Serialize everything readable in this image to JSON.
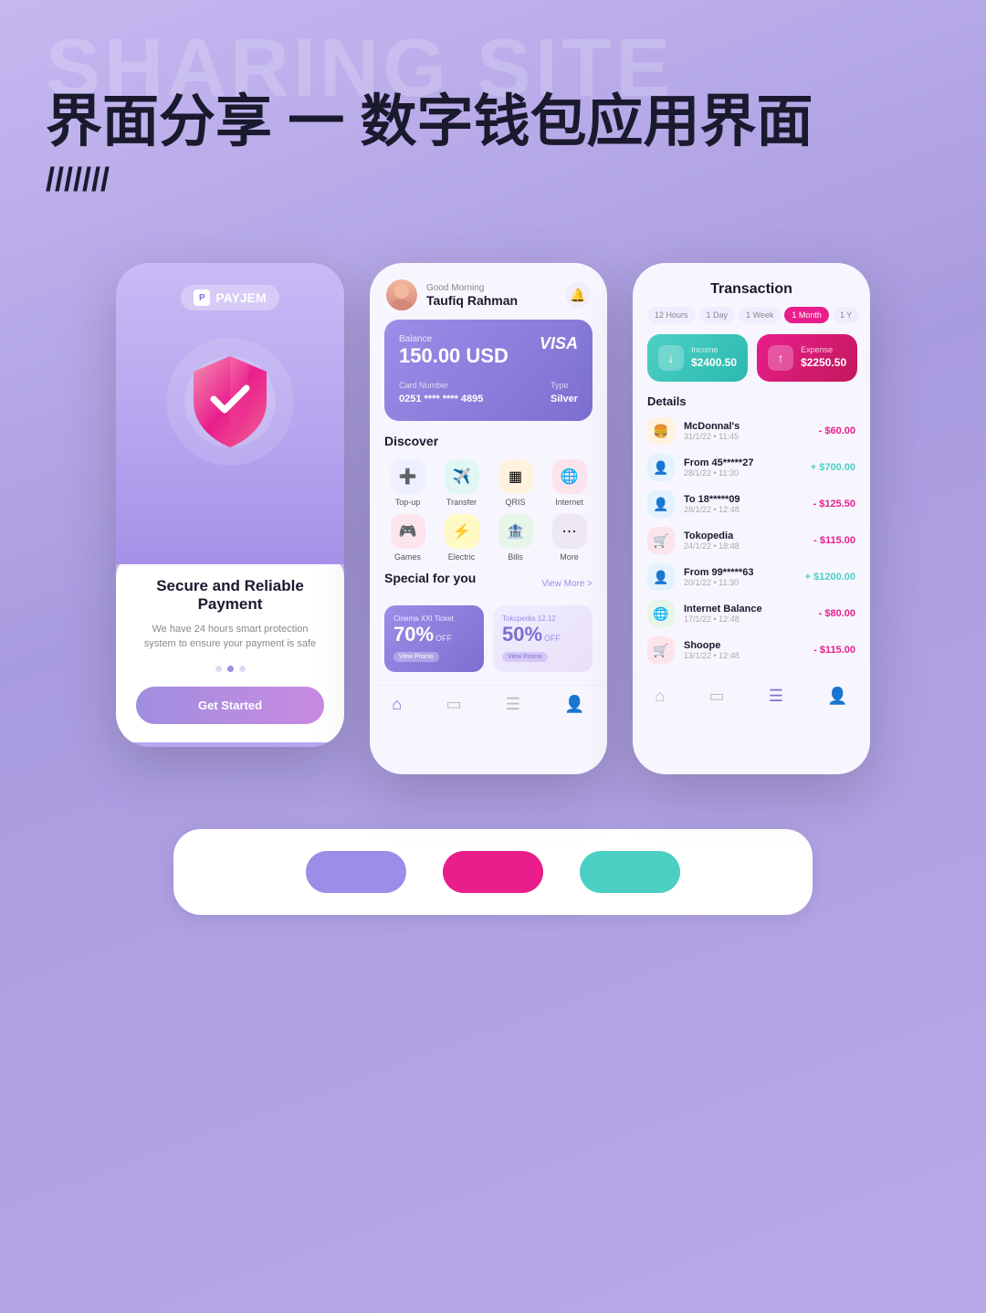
{
  "page": {
    "bg_text": "SHARING SITE",
    "title": "界面分享 一 数字钱包应用界面",
    "subtitle": "///////"
  },
  "phone1": {
    "logo": "PAYJEM",
    "title": "Secure and Reliable Payment",
    "description": "We have 24 hours smart protection system to ensure your payment is safe",
    "cta": "Get Started"
  },
  "phone2": {
    "greeting": "Good Morning",
    "user": "Taufiq Rahman",
    "card": {
      "balance_label": "Balance",
      "balance": "150.00 USD",
      "brand": "VISA",
      "number_label": "Card Number",
      "number": "0251 **** **** 4895",
      "type_label": "Type",
      "type": "Silver"
    },
    "discover": {
      "title": "Discover",
      "items": [
        {
          "label": "Top-up",
          "icon": "➕"
        },
        {
          "label": "Transfer",
          "icon": "✈"
        },
        {
          "label": "QRIS",
          "icon": "◼"
        },
        {
          "label": "Internet",
          "icon": "🌐"
        },
        {
          "label": "Games",
          "icon": "🎮"
        },
        {
          "label": "Electric",
          "icon": "⚡"
        },
        {
          "label": "Bills",
          "icon": "🏦"
        },
        {
          "label": "More",
          "icon": "⋮⋮"
        }
      ]
    },
    "special": {
      "title": "Special for you",
      "view_more": "View More >",
      "promos": [
        {
          "label": "Cinema XXI Ticket",
          "discount": "70%",
          "off": "OFF",
          "btn": "View Promo"
        },
        {
          "label": "Tokopedia 12.12",
          "discount": "50%",
          "off": "OFF",
          "btn": "View Promo"
        }
      ]
    }
  },
  "phone3": {
    "title": "Transaction",
    "filters": [
      "12 Hours",
      "1 Day",
      "1 Week",
      "1 Month",
      "1 Y"
    ],
    "active_filter": "1 Month",
    "income": {
      "label": "Income",
      "amount": "$2400.50"
    },
    "expense": {
      "label": "Expense",
      "amount": "$2250.50"
    },
    "details_title": "Details",
    "transactions": [
      {
        "name": "McDonnal's",
        "date": "31/1/22 • 11:45",
        "amount": "- $60.00",
        "type": "negative"
      },
      {
        "name": "From 45*****27",
        "date": "28/1/22 • 11:30",
        "amount": "+ $700.00",
        "type": "positive"
      },
      {
        "name": "To 18*****09",
        "date": "28/1/22 • 12:48",
        "amount": "- $125.50",
        "type": "negative"
      },
      {
        "name": "Tokopedia",
        "date": "24/1/22 • 18:48",
        "amount": "- $115.00",
        "type": "negative"
      },
      {
        "name": "From 99*****63",
        "date": "20/1/22 • 11:30",
        "amount": "+ $1200.00",
        "type": "positive"
      },
      {
        "name": "Internet Balance",
        "date": "17/1/22 • 12:48",
        "amount": "- $80.00",
        "type": "negative"
      },
      {
        "name": "Shoope",
        "date": "13/1/22 • 12:48",
        "amount": "- $115.00",
        "type": "negative"
      }
    ]
  },
  "palette": {
    "colors": [
      "#9b8ee8",
      "#e91e8c",
      "#4dd0c4"
    ],
    "labels": [
      "purple",
      "pink",
      "teal"
    ]
  }
}
